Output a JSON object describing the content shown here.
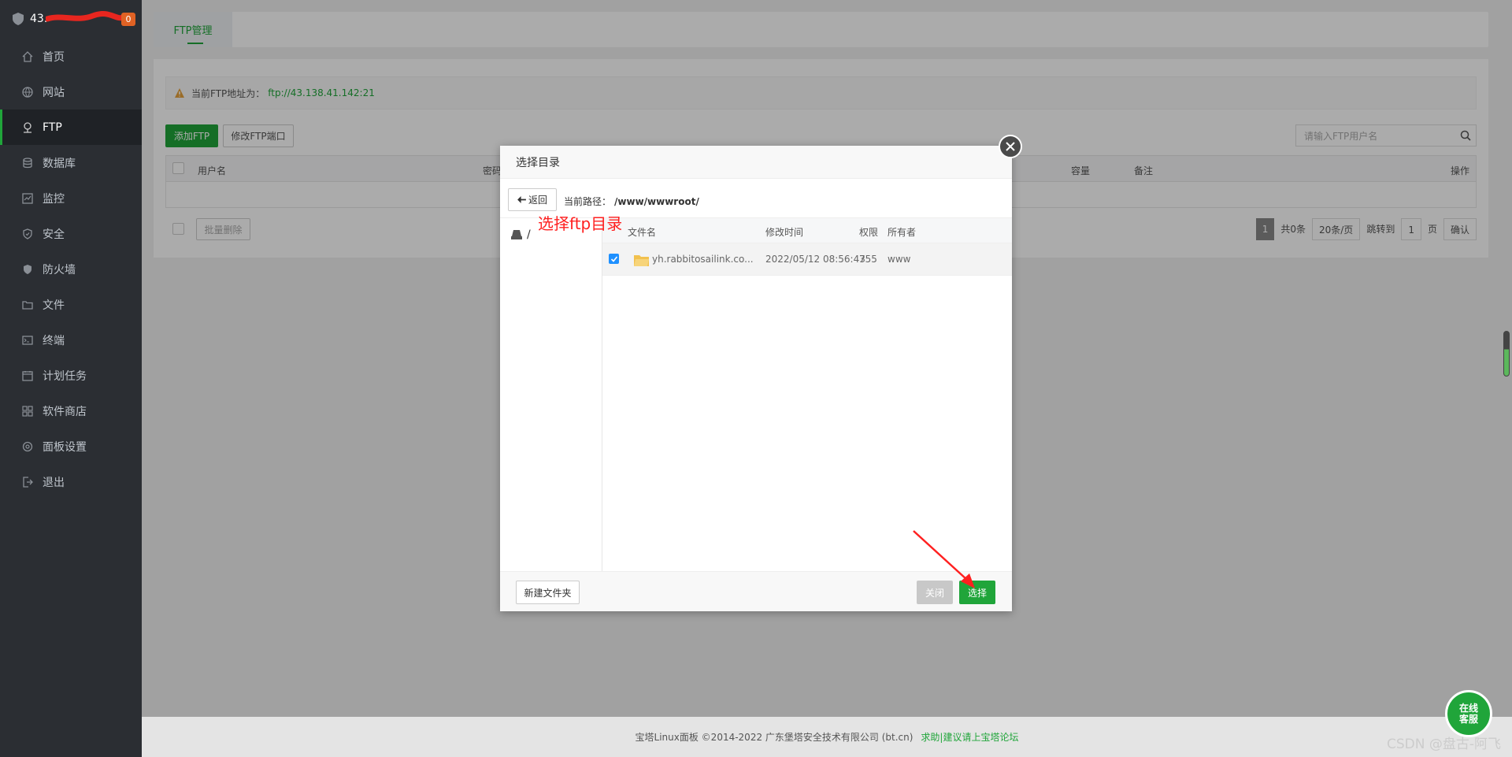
{
  "sidebar": {
    "server_ip": "43.",
    "badge": "0",
    "items": [
      {
        "label": "首页",
        "icon": "home-icon"
      },
      {
        "label": "网站",
        "icon": "globe-icon"
      },
      {
        "label": "FTP",
        "icon": "ftp-icon"
      },
      {
        "label": "数据库",
        "icon": "database-icon"
      },
      {
        "label": "监控",
        "icon": "monitor-icon"
      },
      {
        "label": "安全",
        "icon": "shield-icon"
      },
      {
        "label": "防火墙",
        "icon": "firewall-icon"
      },
      {
        "label": "文件",
        "icon": "folder-icon"
      },
      {
        "label": "终端",
        "icon": "terminal-icon"
      },
      {
        "label": "计划任务",
        "icon": "calendar-icon"
      },
      {
        "label": "软件商店",
        "icon": "apps-icon"
      },
      {
        "label": "面板设置",
        "icon": "settings-icon"
      },
      {
        "label": "退出",
        "icon": "logout-icon"
      }
    ],
    "active_index": 2
  },
  "tabs": {
    "ftp_manage": "FTP管理"
  },
  "notice": {
    "label": "当前FTP地址为：",
    "address": "ftp://43.138.41.142:21"
  },
  "toolbar": {
    "add_ftp": "添加FTP",
    "modify_port": "修改FTP端口",
    "search_placeholder": "请输入FTP用户名"
  },
  "table": {
    "headers": {
      "username": "用户名",
      "password": "密码",
      "capacity": "容量",
      "remark": "备注",
      "actions": "操作"
    },
    "batch_delete": "批量删除"
  },
  "pager": {
    "current": "1",
    "total": "共0条",
    "per_page": "20条/页",
    "jump_label": "跳转到",
    "jump_value": "1",
    "page_unit": "页",
    "confirm": "确认"
  },
  "modal": {
    "title": "选择目录",
    "back": "返回",
    "path_label": "当前路径：",
    "path": "/www/wwwroot/",
    "tree_root": "/",
    "columns": {
      "name": "文件名",
      "mtime": "修改时间",
      "perm": "权限",
      "owner": "所有者"
    },
    "rows": [
      {
        "name": "yh.rabbitosailink.co...",
        "mtime": "2022/05/12 08:56:43",
        "perm": "755",
        "owner": "www",
        "checked": true
      }
    ],
    "new_folder": "新建文件夹",
    "close": "关闭",
    "select": "选择"
  },
  "annotation": {
    "text": "选择ftp目录",
    "color": "#ff2020"
  },
  "footer": {
    "copyright": "宝塔Linux面板 ©2014-2022 广东堡塔安全技术有限公司 (bt.cn)",
    "link": "求助|建议请上宝塔论坛"
  },
  "chat": {
    "line1": "在线",
    "line2": "客服"
  },
  "watermark": "CSDN @盘古-阿飞",
  "colors": {
    "accent": "#20a53a",
    "sidebar_bg": "#2b2e33",
    "badge": "#e06224"
  }
}
